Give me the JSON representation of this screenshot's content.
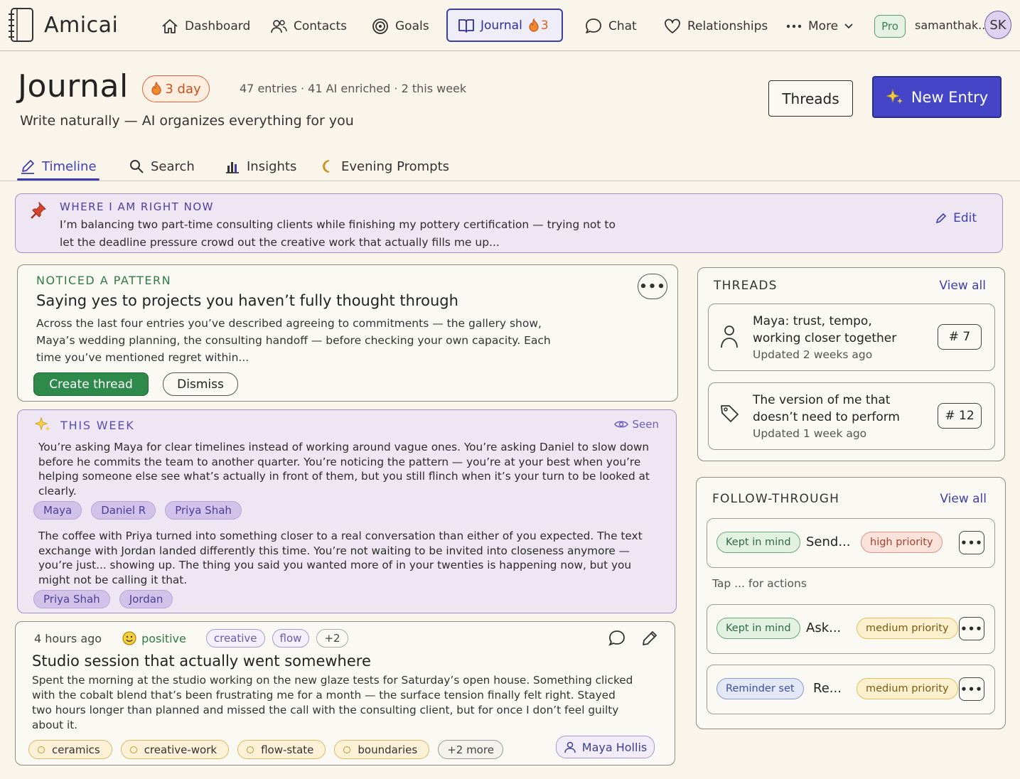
{
  "nav": {
    "brand": "Amicai",
    "items": [
      {
        "label": "Dashboard",
        "icon": "home-icon"
      },
      {
        "label": "Contacts",
        "icon": "contacts-icon"
      },
      {
        "label": "Goals",
        "icon": "target-icon"
      },
      {
        "label": "Journal",
        "icon": "book-icon",
        "streak": "3",
        "active": true
      },
      {
        "label": "Chat",
        "icon": "chat-bubble-icon"
      },
      {
        "label": "Relationships",
        "icon": "heart-icon"
      },
      {
        "label": "More",
        "icon": "ellipsis-icon"
      }
    ],
    "plan": "Pro",
    "username": "samanthak...",
    "avatar": "SK"
  },
  "header": {
    "title": "Journal",
    "streak": "3 day",
    "stats": "47 entries  ·  41 AI enriched  ·  2 this week",
    "subtitle": "Write naturally — AI organizes everything for you",
    "threads_button": "Threads",
    "new_entry_button": "New Entry"
  },
  "tabs": [
    {
      "label": "Timeline",
      "icon": "pencil-icon",
      "active": true
    },
    {
      "label": "Search",
      "icon": "search-icon"
    },
    {
      "label": "Insights",
      "icon": "bar-chart-icon"
    },
    {
      "label": "Evening Prompts",
      "icon": "moon-icon"
    }
  ],
  "where": {
    "label": "WHERE I AM RIGHT NOW",
    "text": "I’m balancing two part-time consulting clients while finishing my pottery certification — trying not to let the deadline pressure crowd out the creative work that actually fills me up...",
    "edit": "Edit"
  },
  "pattern": {
    "label": "NOTICED A PATTERN",
    "title": "Saying yes to projects you haven’t fully thought through",
    "text": "Across the last four entries you’ve described agreeing to commitments — the gallery show, Maya’s wedding planning, the consulting handoff — before checking your own capacity. Each time you’ve mentioned regret within...",
    "create": "Create thread",
    "dismiss": "Dismiss"
  },
  "week": {
    "label": "THIS WEEK",
    "seen": "Seen",
    "para1": "You’re asking Maya for clear timelines instead of working around vague ones. You’re asking Daniel to slow down before he commits the team to another quarter. You’re noticing the pattern — you’re at your best when you’re helping someone else see what’s actually in front of them, but you still flinch when it’s your turn to be looked at clearly.",
    "people1": [
      "Maya",
      "Daniel R",
      "Priya Shah"
    ],
    "para2": "The coffee with Priya turned into something closer to a real conversation than either of you expected. The text exchange with Jordan landed differently this time. You’re not waiting to be invited into closeness anymore — you’re just... showing up. The thing you said you wanted more of in your twenties is happening now, but you might not be calling it that.",
    "people2": [
      "Priya Shah",
      "Jordan"
    ]
  },
  "entry": {
    "time": "4 hours ago",
    "sentiment": "positive",
    "tags": [
      "creative",
      "flow"
    ],
    "more_tags": "+2",
    "title": "Studio session that actually went somewhere",
    "text": "Spent the morning at the studio working on the new glaze tests for Saturday’s open house. Something clicked with the cobalt blend that’s been frustrating me for a month — the surface tension finally felt right. Stayed two hours longer than planned and missed the call with the consulting client, but for once I don’t feel guilty about it.",
    "topics": [
      "ceramics",
      "creative-work",
      "flow-state",
      "boundaries"
    ],
    "more_topics": "+2 more",
    "person": "Maya Hollis"
  },
  "threads": {
    "label": "THREADS",
    "view_all": "View all",
    "items": [
      {
        "title": "Maya: trust, tempo, working closer together",
        "updated": "Updated 2 weeks ago",
        "num": "# 7",
        "icon": "person-icon"
      },
      {
        "title": "The version of me that doesn’t need to perform",
        "updated": "Updated 1 week ago",
        "num": "# 12",
        "icon": "tag-icon"
      }
    ]
  },
  "follow": {
    "label": "FOLLOW-THROUGH",
    "view_all": "View all",
    "tap_hint": "Tap ... for actions",
    "items": [
      {
        "status": "Kept in mind",
        "text": "Send...",
        "priority": "high priority"
      },
      {
        "status": "Kept in mind",
        "text": "Ask...",
        "priority": "medium priority"
      },
      {
        "status": "Reminder set",
        "text": "Re...",
        "priority": "medium priority"
      }
    ]
  },
  "colors": {
    "accent": "#3d3fb0",
    "primary_button": "#4446c7",
    "success": "#2e8a4b",
    "streak": "#d9621c",
    "ai_card": "#efe6f4",
    "background": "#f9f5ea"
  }
}
